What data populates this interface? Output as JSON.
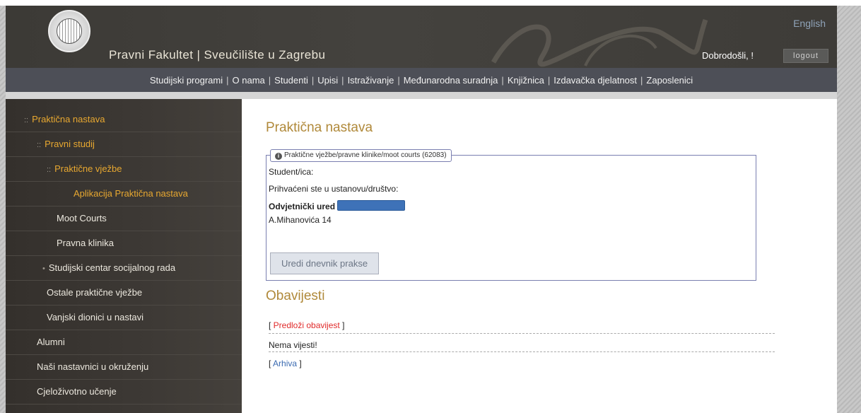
{
  "header": {
    "site_title": "Pravni Fakultet  |  Sveučilište u Zagrebu",
    "language_link": "English",
    "welcome": "Dobrodošli, !",
    "logout_label": "logout"
  },
  "topnav": {
    "items": [
      "Studijski programi",
      "O nama",
      "Studenti",
      "Upisi",
      "Istraživanje",
      "Međunarodna suradnja",
      "Knjižnica",
      "Izdavačka djelatnost",
      "Zaposlenici"
    ]
  },
  "sidebar": {
    "items": [
      {
        "label": "Praktična nastava",
        "bullet": "::"
      },
      {
        "label": "Pravni studij",
        "bullet": "::"
      },
      {
        "label": "Praktične vježbe",
        "bullet": "::"
      },
      {
        "label": "Aplikacija Praktična nastava",
        "bullet": ""
      },
      {
        "label": "Moot Courts",
        "bullet": ""
      },
      {
        "label": "Pravna klinika",
        "bullet": ""
      },
      {
        "label": "Studijski centar socijalnog rada",
        "bullet": "•"
      },
      {
        "label": "Ostale praktične vježbe",
        "bullet": ""
      },
      {
        "label": "Vanjski dionici u nastavi",
        "bullet": ""
      },
      {
        "label": "Alumni",
        "bullet": ""
      },
      {
        "label": "Naši nastavnici u okruženju",
        "bullet": ""
      },
      {
        "label": "Cjeloživotno učenje",
        "bullet": ""
      }
    ]
  },
  "main": {
    "title": "Praktična nastava",
    "panel": {
      "legend": "Praktične vježbe/pravne klinike/moot courts (62083)",
      "student_label": "Student/ica:",
      "accepted_text": "Prihvaćeni ste u ustanovu/društvo:",
      "office_name": "Odvjetnički ured",
      "address": "A.Mihanovića 14",
      "edit_button": "Uredi dnevnik prakse"
    },
    "news": {
      "title": "Obavijesti",
      "submit_link": "Predloži obavijest",
      "empty_text": "Nema vijesti!",
      "archive_link": "Arhiva"
    }
  }
}
